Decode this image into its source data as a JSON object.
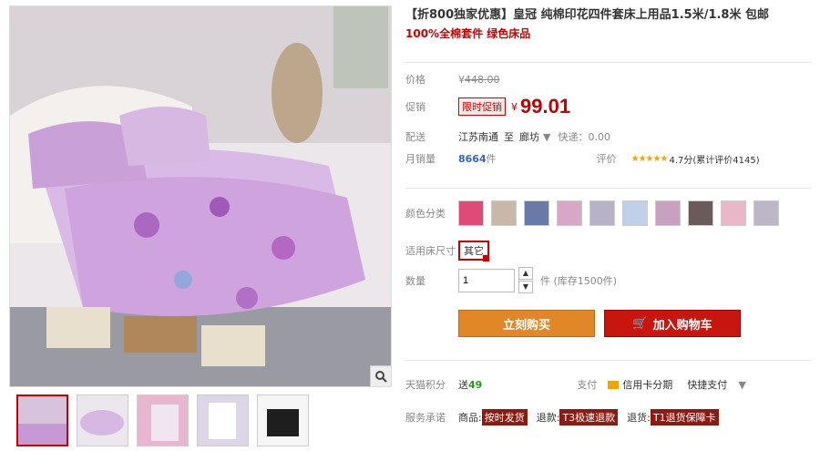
{
  "product": {
    "title": "【折800独家优惠】皇冠 纯棉印花四件套床上用品1.5米/1.8米 包邮",
    "subtitle": "100%全棉套件 绿色床品"
  },
  "price": {
    "label": "价格",
    "currency": "¥",
    "original": "448.00",
    "promo_label": "促销",
    "promo_tag": "限时促销",
    "current": "99.01"
  },
  "shipping": {
    "label": "配送",
    "from": "江苏南通",
    "to_word": "至",
    "dest": "廊坊",
    "express": "快递：0.00"
  },
  "sales": {
    "label": "月销量",
    "count": "8664",
    "unit": "件",
    "review_label": "评价",
    "stars": "★★★★★",
    "score_text": "4.7分(累计评价4145)"
  },
  "color": {
    "label": "颜色分类",
    "swatches": [
      "#e04a78",
      "#c9b8a8",
      "#6a7aa8",
      "#d8a6c6",
      "#b8b2c8",
      "#c0d0e8",
      "#c8a0c0",
      "#6a5a5a",
      "#e8b8c8",
      "#bdb6c6"
    ]
  },
  "size": {
    "label": "适用床尺寸",
    "value": "其它"
  },
  "quantity": {
    "label": "数量",
    "value": "1",
    "stock": "件 (库存1500件)"
  },
  "actions": {
    "buy_now": "立刻购买",
    "add_to_cart": "加入购物车"
  },
  "points": {
    "label": "天猫积分",
    "value_prefix": "送",
    "value": "49",
    "pay_label": "支付",
    "credit_label": "信用卡分期",
    "quick_pay": "快捷支付"
  },
  "service": {
    "label": "服务承诺",
    "items": [
      {
        "prefix": "商品:",
        "tag": "按时发货"
      },
      {
        "prefix": "退款:",
        "tag": "T3极速退款"
      },
      {
        "prefix": "退货:",
        "tag": "T1退货保障卡"
      }
    ]
  }
}
